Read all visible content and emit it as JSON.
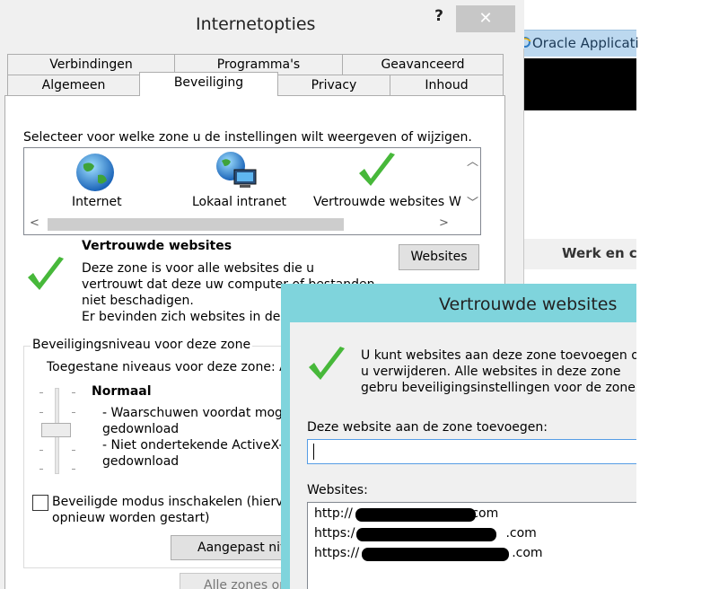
{
  "browser": {
    "tab_label": "Oracle Applicati",
    "strip_text": "Werk en c"
  },
  "dialog": {
    "title": "Internetopties",
    "help": "?",
    "close": "✕"
  },
  "tabs": {
    "row1": [
      "Verbindingen",
      "Programma's",
      "Geavanceerd"
    ],
    "row2": [
      "Algemeen",
      "Beveiliging",
      "Privacy",
      "Inhoud"
    ],
    "active": "Beveiliging"
  },
  "security": {
    "zone_prompt": "Selecteer voor welke zone u de instellingen wilt weergeven of wijzigen.",
    "zones": [
      "Internet",
      "Lokaal intranet",
      "Vertrouwde websites",
      "W"
    ],
    "selected_zone_title": "Vertrouwde websites",
    "zone_description": "Deze zone is voor alle websites die u vertrouwt dat deze uw computer of bestanden niet beschadigen.",
    "zone_description_2": "Er bevinden zich websites in deze",
    "websites_button": "Websites",
    "group_label": "Beveiligingsniveau voor deze zone",
    "allowed_levels": "Toegestane niveaus voor deze zone: A",
    "level_name": "Normaal",
    "level_desc_1": "- Waarschuwen voordat moge",
    "level_desc_2": "gedownload",
    "level_desc_3": "- Niet ondertekende ActiveX-b",
    "level_desc_4": "gedownload",
    "protected_mode_label_1": "Beveiligde modus inschakelen (hiervo",
    "protected_mode_label_2": "opnieuw worden gestart)",
    "custom_level_button": "Aangepast niv",
    "all_zones_button": "Alle zones or"
  },
  "trusted_sites": {
    "title": "Vertrouwde websites",
    "info_text": "U kunt websites aan deze zone toevoegen of u verwijderen. Alle websites in deze zone gebru beveiligingsinstellingen voor de zone.",
    "add_label": "Deze website aan de zone toevoegen:",
    "add_value": "",
    "sites_label": "Websites:",
    "sites": [
      {
        "prefix": "http://",
        "suffix": ".com"
      },
      {
        "prefix": "https:/",
        "suffix": ".com"
      },
      {
        "prefix": "https://",
        "suffix": ".com"
      }
    ]
  }
}
